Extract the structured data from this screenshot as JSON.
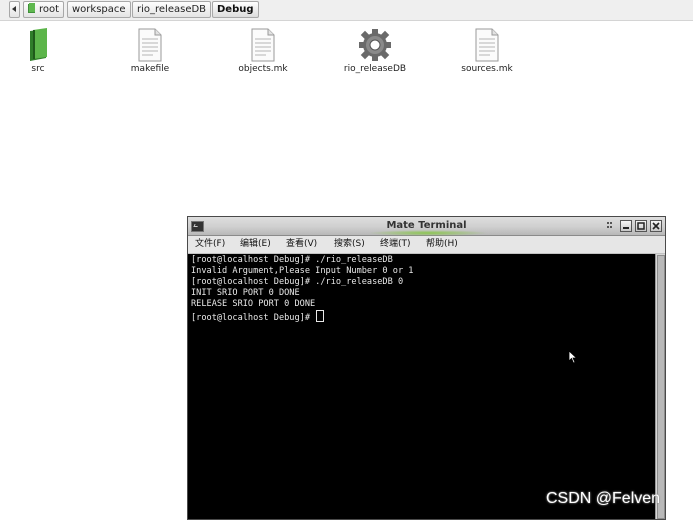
{
  "breadcrumb": {
    "items": [
      {
        "label": "root",
        "icon": "home-icon"
      },
      {
        "label": "workspace"
      },
      {
        "label": "rio_releaseDB"
      },
      {
        "label": "Debug",
        "active": true
      }
    ]
  },
  "files": [
    {
      "name": "src",
      "icon": "green-book-folder-icon"
    },
    {
      "name": "makefile",
      "icon": "text-document-icon"
    },
    {
      "name": "objects.mk",
      "icon": "text-document-icon"
    },
    {
      "name": "rio_releaseDB",
      "icon": "gear-executable-icon"
    },
    {
      "name": "sources.mk",
      "icon": "text-document-icon"
    }
  ],
  "terminal": {
    "title": "Mate Terminal",
    "menu": [
      "文件(F)",
      "编辑(E)",
      "查看(V)",
      "搜索(S)",
      "终端(T)",
      "帮助(H)"
    ],
    "lines": [
      "[root@localhost Debug]# ./rio_releaseDB",
      "Invalid Argument,Please Input Number 0 or 1",
      "[root@localhost Debug]# ./rio_releaseDB 0",
      "INIT SRIO PORT 0 DONE",
      "RELEASE SRIO PORT 0 DONE"
    ],
    "prompt": "[root@localhost Debug]# "
  },
  "watermark": "CSDN @Felven"
}
